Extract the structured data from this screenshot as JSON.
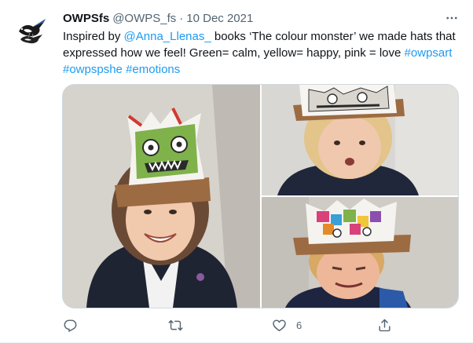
{
  "tweet": {
    "display_name": "OWPSfs",
    "handle": "@OWPS_fs",
    "separator": "·",
    "date": "10 Dec 2021",
    "text_segments": {
      "s1": "Inspired by ",
      "mention": "@Anna_Llenas_",
      "s2": " books ‘The colour monster’ we made hats that expressed how we feel! Green= calm, yellow= happy, pink = love ",
      "tag1": "#owpsart",
      "tag2": "#owpspshe",
      "tag3": "#emotions"
    },
    "media": {
      "photos": [
        "girl-green-monster-hat",
        "child-monster-hat-closeup",
        "boy-colourful-monster-hat"
      ]
    },
    "actions": {
      "reply_icon": "reply-icon",
      "retweet_icon": "retweet-icon",
      "like_icon": "heart-icon",
      "like_count": "6",
      "share_icon": "share-icon"
    },
    "colors": {
      "link": "#1d9bf0",
      "secondary_text": "#536471",
      "primary_text": "#0f1419",
      "border": "#cfd9de"
    }
  }
}
